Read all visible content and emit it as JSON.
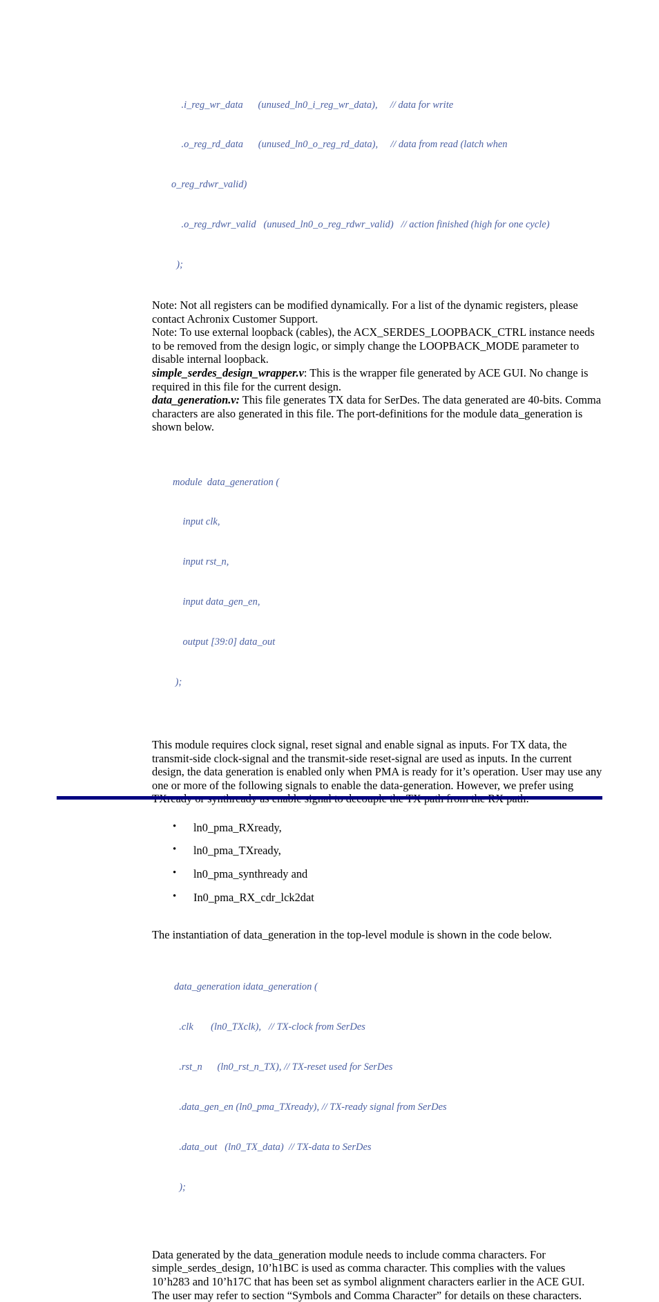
{
  "document": {
    "type": "technical-reference-page",
    "accent_color": "#000080",
    "code_color": "#4a5fa2",
    "body_color": "#000000",
    "background_color": "#ffffff"
  },
  "code_block_1": {
    "lines": [
      "    .i_reg_wr_data      (unused_ln0_i_reg_wr_data),     // data for write",
      "    .o_reg_rd_data      (unused_ln0_o_reg_rd_data),     // data from read (latch when",
      "o_reg_rdwr_valid)",
      "    .o_reg_rdwr_valid   (unused_ln0_o_reg_rdwr_valid)   // action finished (high for one cycle)",
      "  );"
    ]
  },
  "note_1": {
    "text": "Note: Not all registers can be modified dynamically. For a list of the dynamic registers, please contact Achronix Customer Support."
  },
  "note_2": {
    "text": "Note: To use external loopback (cables), the ACX_SERDES_LOOPBACK_CTRL instance needs to be removed from the design logic, or simply change the LOOPBACK_MODE parameter to disable internal loopback."
  },
  "para_wrapper": {
    "lead": "simple_serdes_design_wrapper.v",
    "text": ": This is the wrapper file generated by ACE GUI. No change is required in this file for the current design."
  },
  "para_datagen": {
    "lead": "data_generation.v:",
    "text": " This file generates TX data for SerDes. The data generated are 40-bits. Comma characters are also generated in this file. The port-definitions for the module data_generation is shown below."
  },
  "code_block_2": {
    "lines": [
      "module  data_generation (",
      "    input clk,",
      "    input rst_n,",
      "    input data_gen_en,",
      "    output [39:0] data_out",
      " );"
    ]
  },
  "para_module_requires": {
    "text": "This module requires clock signal, reset signal and enable signal as inputs. For TX data, the transmit-side clock-signal and the transmit-side reset-signal are used as inputs. In the current design, the data generation is enabled only when PMA is ready for it’s operation. User may use any one or more of the following signals to enable the data-generation. However, we prefer using TXready or synthready as enable signal to decouple the TX path from the RX path:"
  },
  "signal_list": {
    "items": [
      "ln0_pma_RXready,",
      "ln0_pma_TXready,",
      "ln0_pma_synthready and",
      "In0_pma_RX_cdr_lck2dat"
    ]
  },
  "para_instantiation": {
    "text": "The instantiation of data_generation in the top-level module is shown in the code below."
  },
  "code_block_3": {
    "lines": [
      "data_generation idata_generation (",
      "  .clk       (ln0_TXclk),   // TX-clock from SerDes",
      "  .rst_n      (ln0_rst_n_TX), // TX-reset used for SerDes",
      "  .data_gen_en (ln0_pma_TXready), // TX-ready signal from SerDes",
      "  .data_out   (ln0_TX_data)  // TX-data to SerDes",
      "  );"
    ]
  },
  "para_comma": {
    "text": "Data generated by the data_generation module needs to include comma characters. For simple_serdes_design, 10’h1BC is used as comma character. This complies with the values 10’h283 and 10’h17C that has been set as symbol alignment characters earlier in the ACE GUI. The user may refer to section “Symbols and Comma Character” for details on these characters."
  }
}
